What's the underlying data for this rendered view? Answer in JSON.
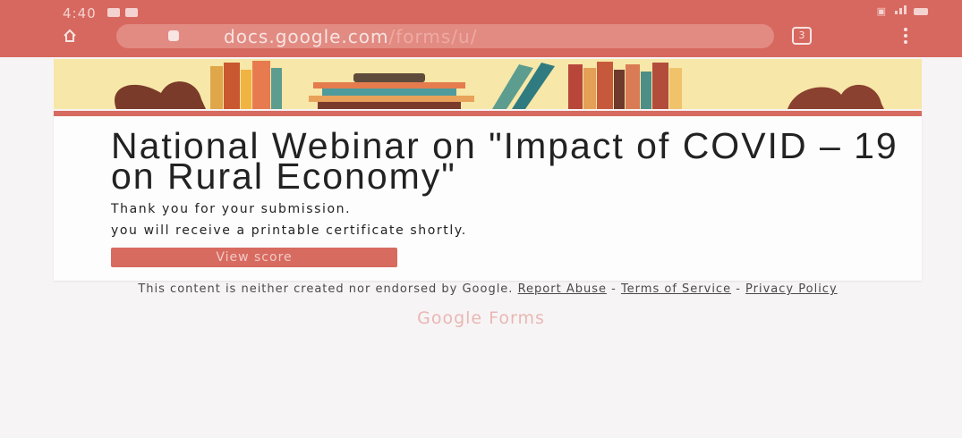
{
  "status_bar": {
    "time": "4:40",
    "icons": [
      "mail-icon",
      "mail-icon",
      "alarm-icon",
      "signal-icon",
      "battery-icon"
    ]
  },
  "browser": {
    "url_host": "docs.google.com",
    "url_path": "/forms/u/",
    "tab_count": "3",
    "icons": [
      "home-icon",
      "lock-icon",
      "tabs-icon",
      "menu-icon"
    ]
  },
  "colors": {
    "accent": "#d76b60",
    "browser_bar": "#d7685f",
    "banner_bg": "#f7e7a8"
  },
  "form": {
    "title": "National Webinar on \"Impact of COVID – 19 on Rural Economy\"",
    "confirmation_line1": "Thank you for your submission.",
    "confirmation_line2": "you will receive a printable certificate shortly.",
    "view_score_label": "View score"
  },
  "footer": {
    "disclaimer_prefix": "This content is neither created nor endorsed by Google.",
    "report_abuse": "Report Abuse",
    "terms": "Terms of Service",
    "privacy": "Privacy Policy",
    "separator": " - ",
    "logo_text": "Google Forms"
  }
}
